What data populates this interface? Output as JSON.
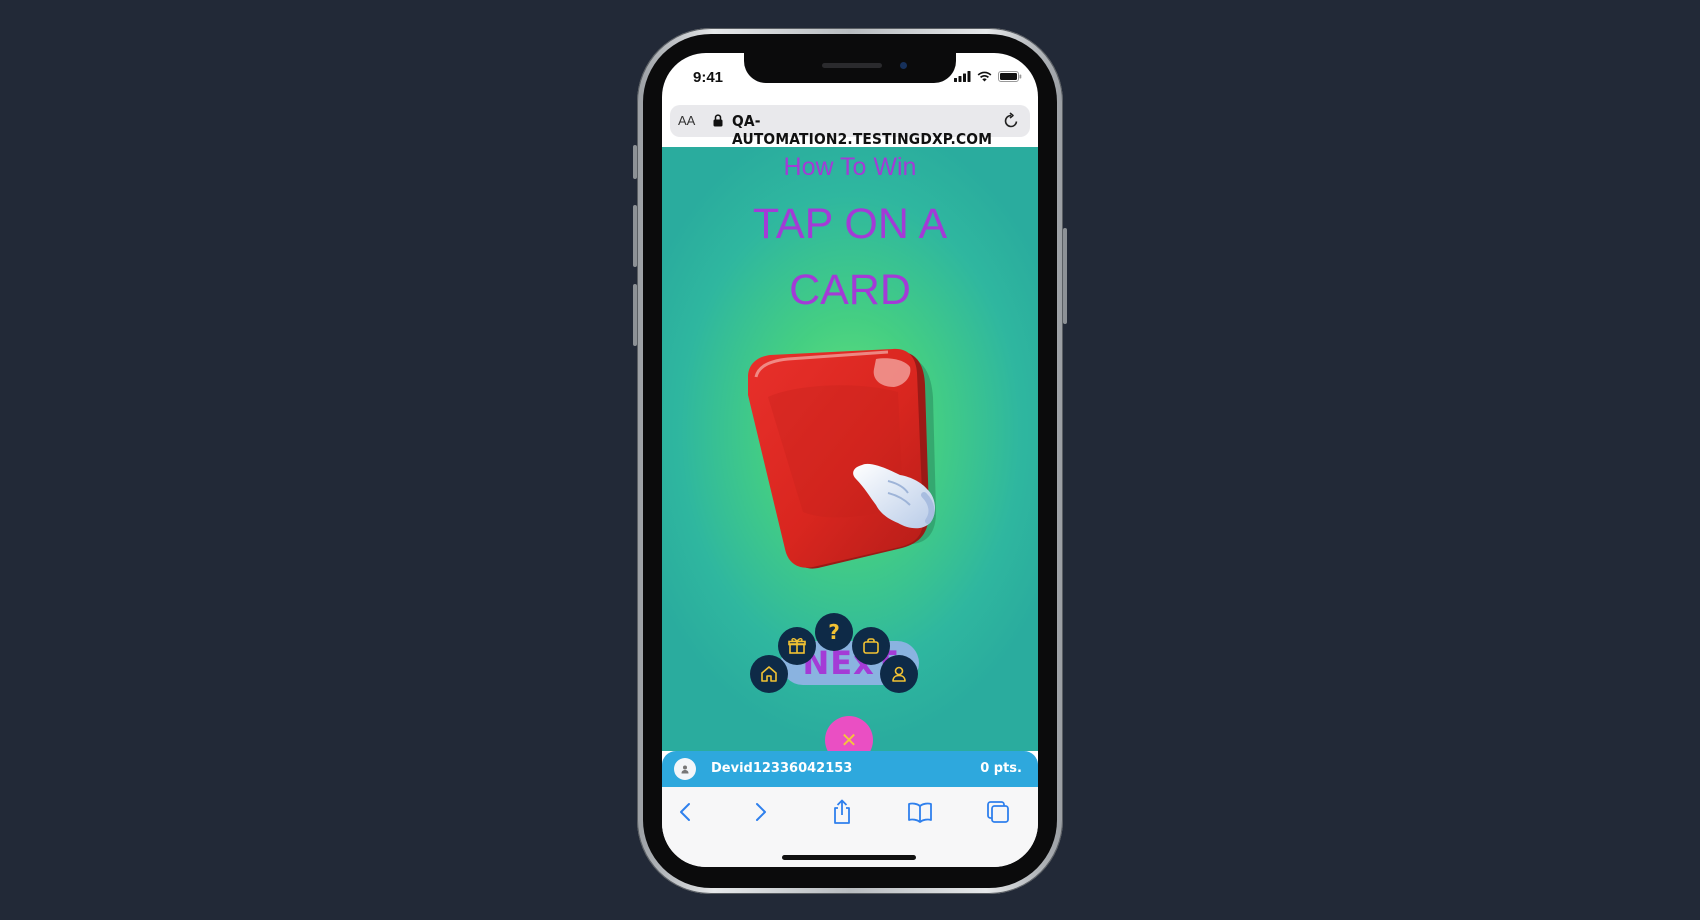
{
  "status_bar": {
    "time": "9:41"
  },
  "browser": {
    "text_size_label": "AA",
    "url": "QA-AUTOMATION2.TESTINGDXP.COM"
  },
  "game": {
    "heading": "How To Win",
    "instruction_line1": "TAP ON A",
    "instruction_line2": "CARD",
    "next_label": "NExT",
    "help_symbol": "?",
    "close_symbol": "✕",
    "nav_icons": [
      "home-icon",
      "gift-icon",
      "help-icon",
      "bag-icon",
      "user-icon"
    ]
  },
  "user_bar": {
    "username": "Devid12336042153",
    "points": "0 pts."
  },
  "colors": {
    "title_purple": "#a33bd6",
    "nav_navy": "#0e2a47",
    "nav_icon_yellow": "#f2c233",
    "close_pink": "#ea4fc3",
    "user_bar_blue": "#2ea8dd",
    "card_red": "#d42a2a"
  }
}
